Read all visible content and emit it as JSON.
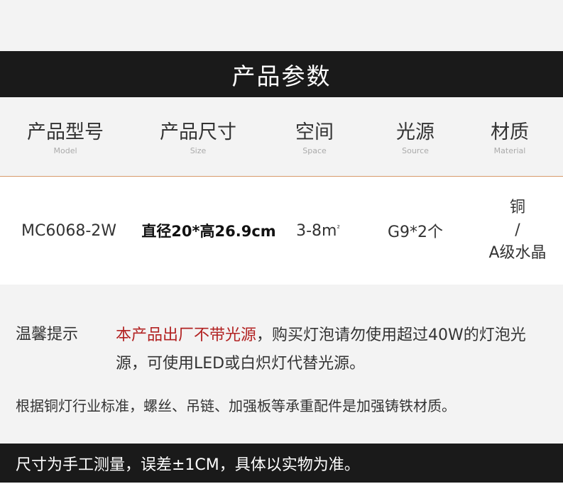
{
  "title": "产品参数",
  "headers": [
    {
      "cn": "产品型号",
      "en": "Model"
    },
    {
      "cn": "产品尺寸",
      "en": "Size"
    },
    {
      "cn": "空间",
      "en": "Space"
    },
    {
      "cn": "光源",
      "en": "Source"
    },
    {
      "cn": "材质",
      "en": "Material"
    }
  ],
  "values": {
    "model": "MC6068-2W",
    "size": "直径20*高26.9cm",
    "space": "3-8m",
    "space_unit_sup": "²",
    "source": "G9*2个",
    "material_line1": "铜",
    "material_line2": "/",
    "material_line3": "A级水晶"
  },
  "notice": {
    "label": "温馨提示",
    "highlight": "本产品出厂不带光源",
    "rest": "，购买灯泡请勿使用超过40W的灯泡光源，可使用LED或白炽灯代替光源。",
    "note2": "根据铜灯行业标准，螺丝、吊链、加强板等承重配件是加强铸铁材质。"
  },
  "footer": "尺寸为手工测量，误差±1CM，具体以实物为准。",
  "colors": {
    "accent_red": "#b22222",
    "divider": "#d79a6a",
    "dark": "#1a1a1a",
    "light_bg": "#f3f3f3"
  }
}
